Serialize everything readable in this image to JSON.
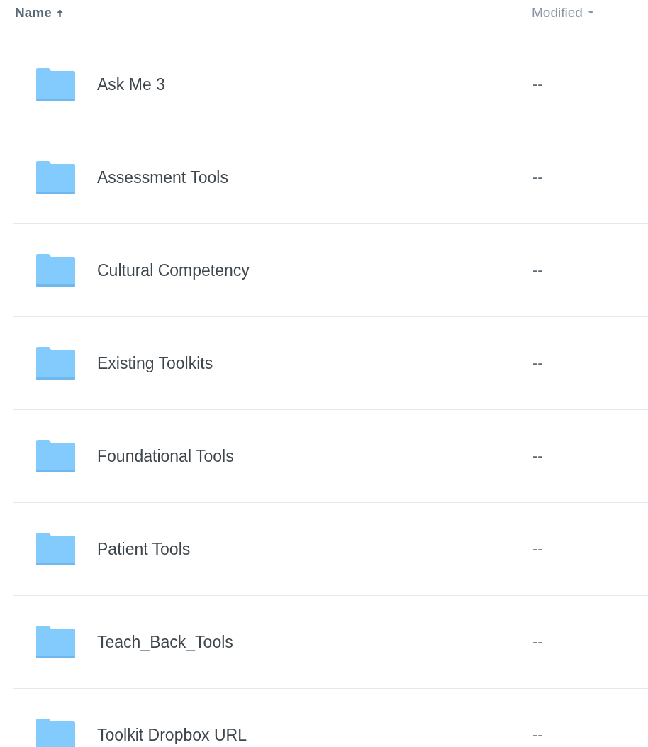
{
  "table": {
    "columns": [
      {
        "label": "Name",
        "sorted": true
      },
      {
        "label": "Modified",
        "sorted": false
      }
    ],
    "rows": [
      {
        "name": "Ask Me 3",
        "modified": "--"
      },
      {
        "name": "Assessment Tools",
        "modified": "--"
      },
      {
        "name": "Cultural Competency",
        "modified": "--"
      },
      {
        "name": "Existing Toolkits",
        "modified": "--"
      },
      {
        "name": "Foundational Tools",
        "modified": "--"
      },
      {
        "name": "Patient Tools",
        "modified": "--"
      },
      {
        "name": "Teach_Back_Tools",
        "modified": "--"
      },
      {
        "name": "Toolkit Dropbox URL",
        "modified": "--"
      }
    ]
  }
}
